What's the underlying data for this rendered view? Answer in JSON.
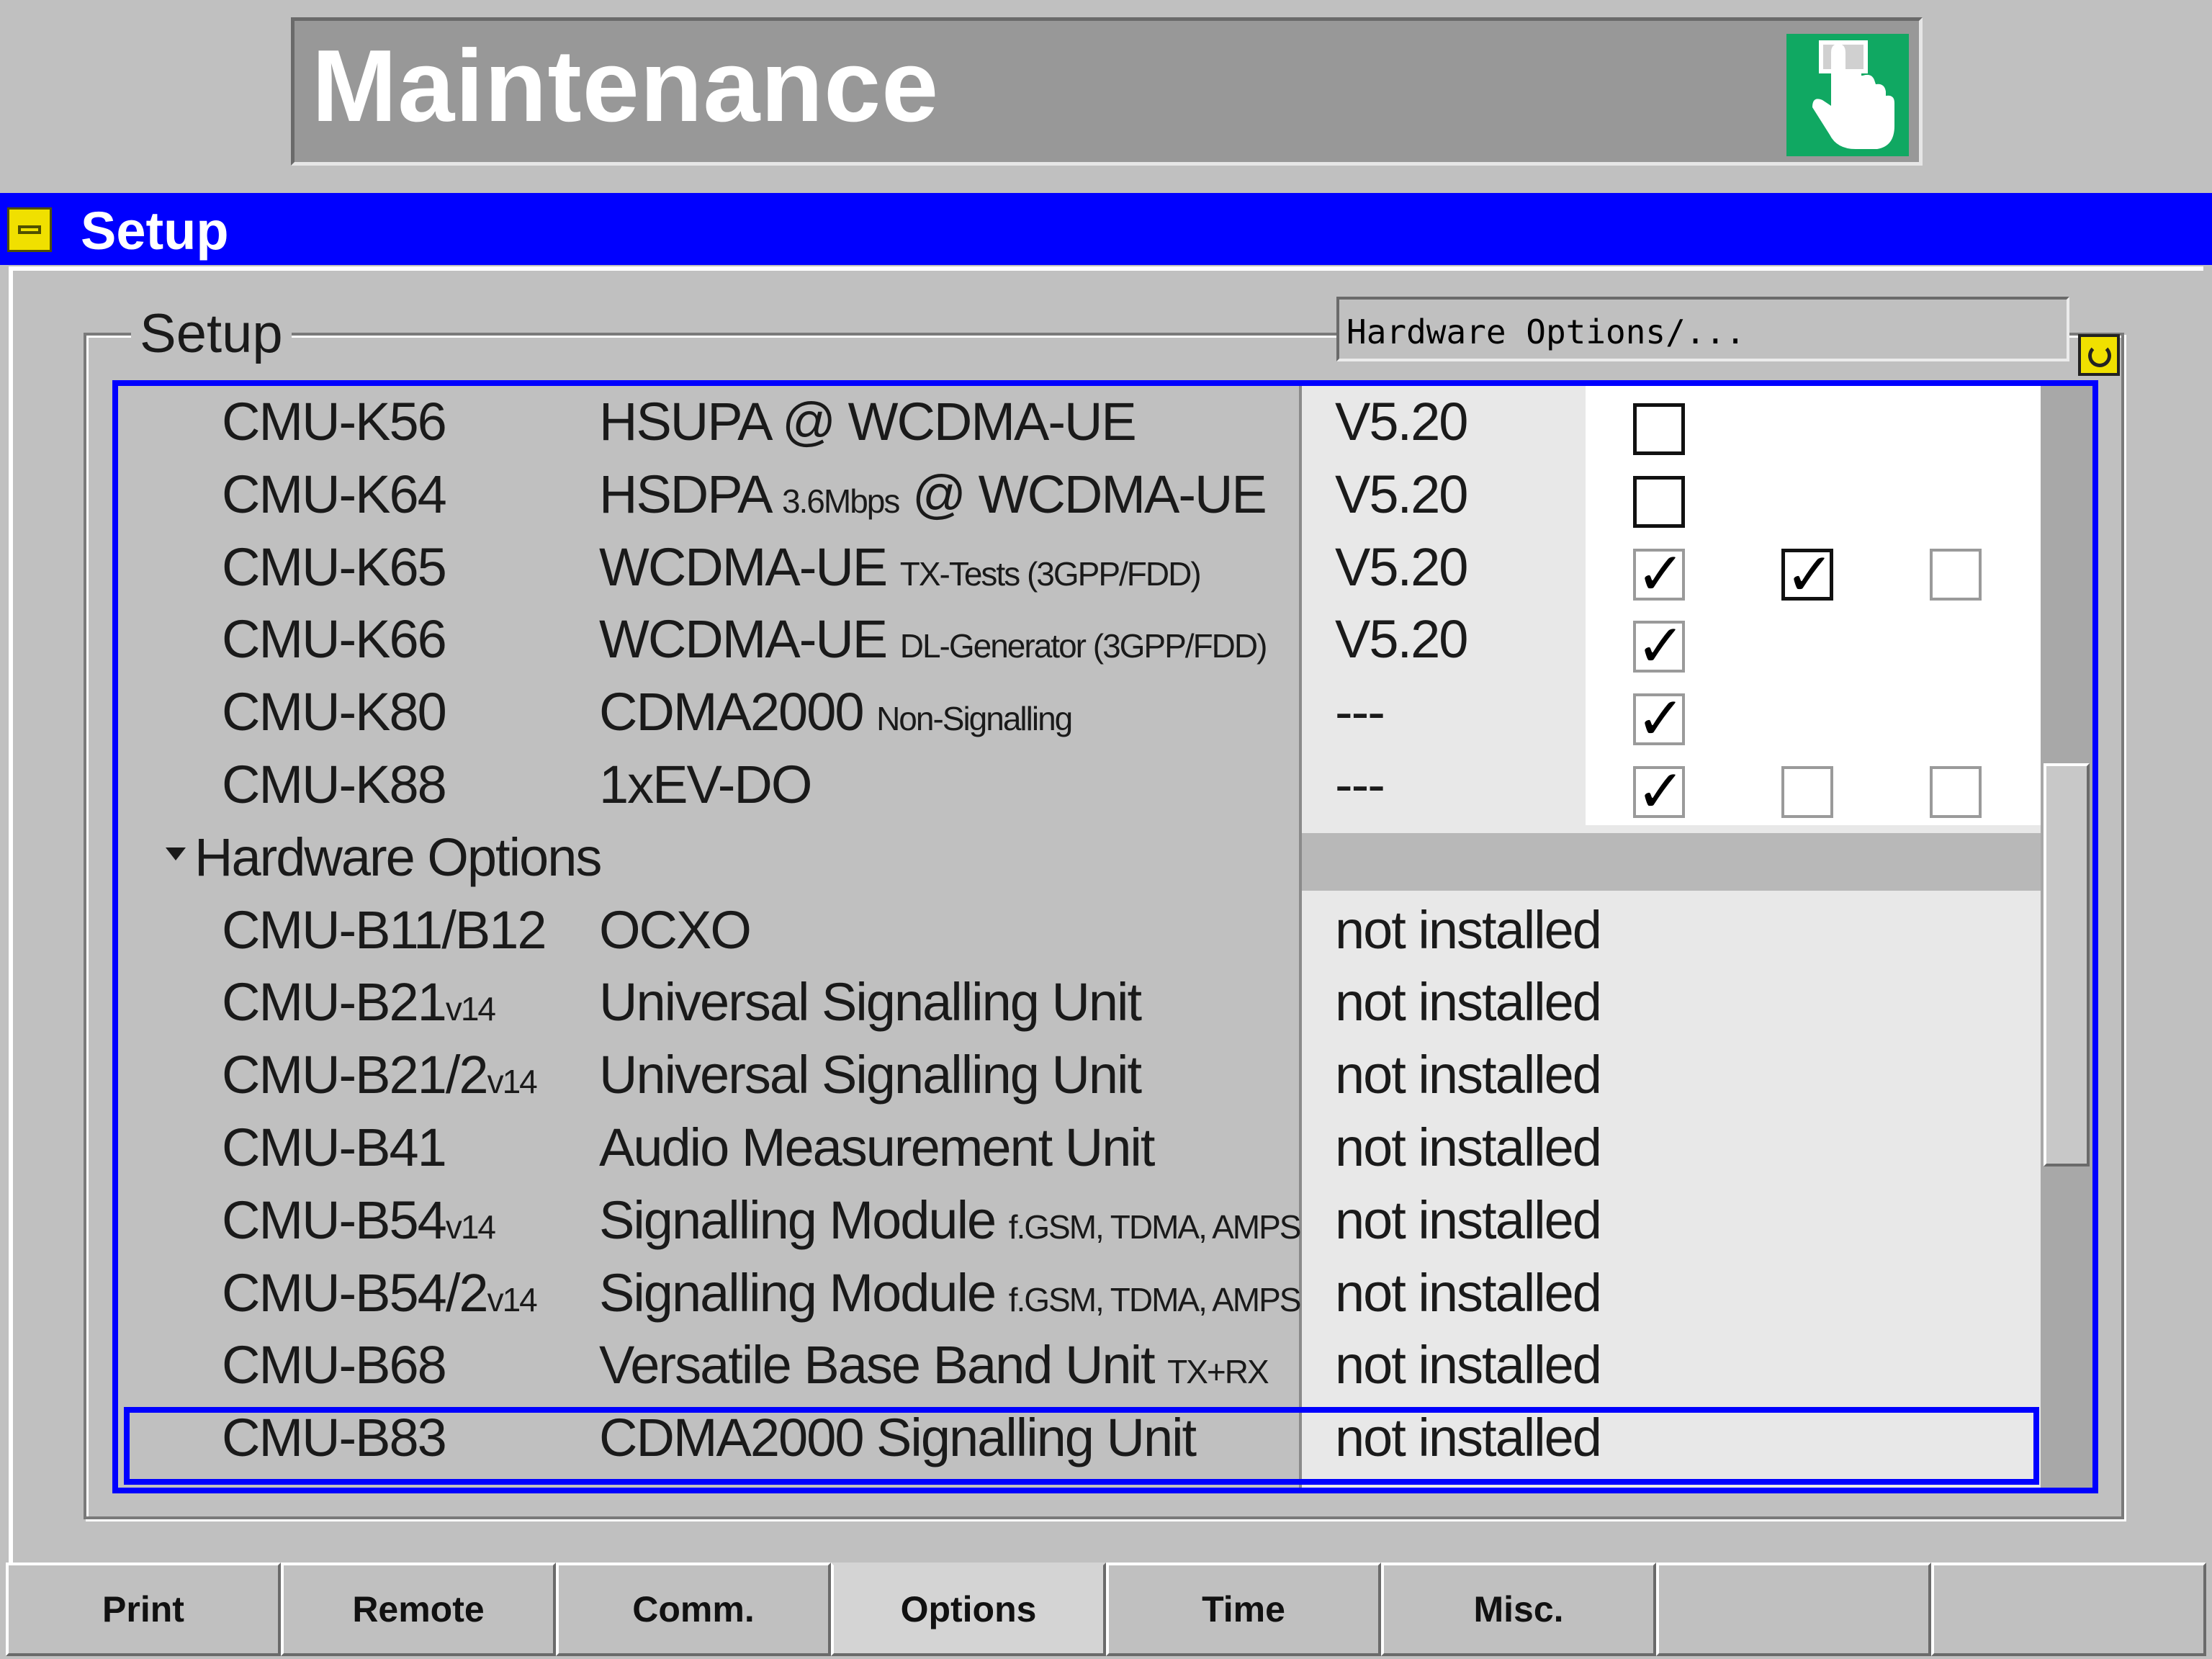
{
  "header": {
    "title": "Maintenance",
    "icon": "hand-pointer-icon",
    "icon_color": "#10a862"
  },
  "window": {
    "title": "Setup",
    "bar_color": "#0000ff"
  },
  "group": {
    "label": "Setup",
    "field_value": "Hardware Options/..."
  },
  "rows": [
    {
      "code": "CMU-K56",
      "code_sub": "",
      "name": "HSUPA @ WCDMA-UE",
      "name_sub": "",
      "value": "V5.20",
      "checkboxes": [
        {
          "state": "unchecked",
          "disabled": false
        }
      ]
    },
    {
      "code": "CMU-K64",
      "code_sub": "",
      "name": "HSDPA ",
      "name_sub": "3.6Mbps",
      "name_tail": " @ WCDMA-UE",
      "value": "V5.20",
      "checkboxes": [
        {
          "state": "unchecked",
          "disabled": false
        }
      ]
    },
    {
      "code": "CMU-K65",
      "code_sub": "",
      "name": "WCDMA-UE ",
      "name_sub": "TX-Tests (3GPP/FDD)",
      "value": "V5.20",
      "checkboxes": [
        {
          "state": "checked",
          "disabled": true
        },
        {
          "state": "checked",
          "disabled": false
        },
        {
          "state": "unchecked",
          "disabled": true
        }
      ]
    },
    {
      "code": "CMU-K66",
      "code_sub": "",
      "name": "WCDMA-UE ",
      "name_sub": "DL-Generator (3GPP/FDD)",
      "value": "V5.20",
      "checkboxes": [
        {
          "state": "checked",
          "disabled": true
        }
      ]
    },
    {
      "code": "CMU-K80",
      "code_sub": "",
      "name": "CDMA2000 ",
      "name_sub": "Non-Signalling",
      "value": "---",
      "checkboxes": [
        {
          "state": "checked",
          "disabled": true
        }
      ]
    },
    {
      "code": "CMU-K88",
      "code_sub": "",
      "name": "1xEV-DO",
      "name_sub": "",
      "value": "---",
      "checkboxes": [
        {
          "state": "checked",
          "disabled": true
        },
        {
          "state": "unchecked",
          "disabled": true
        },
        {
          "state": "unchecked",
          "disabled": true
        }
      ]
    }
  ],
  "section": {
    "label": "Hardware Options"
  },
  "hw_rows": [
    {
      "code": "CMU-B11/B12",
      "code_sub": "",
      "name": "OCXO",
      "name_sub": "",
      "value": "not installed"
    },
    {
      "code": "CMU-B21",
      "code_sub": "v14",
      "name": "Universal Signalling Unit",
      "name_sub": "",
      "value": "not installed"
    },
    {
      "code": "CMU-B21/2",
      "code_sub": "v14",
      "name": "Universal Signalling Unit",
      "name_sub": "",
      "value": "not installed"
    },
    {
      "code": "CMU-B41",
      "code_sub": "",
      "name": "Audio Measurement Unit",
      "name_sub": "",
      "value": "not installed"
    },
    {
      "code": "CMU-B54",
      "code_sub": "v14",
      "name": "Signalling Module ",
      "name_sub": "f.GSM, TDMA, AMPS",
      "value": "not installed"
    },
    {
      "code": "CMU-B54/2",
      "code_sub": "v14",
      "name": "Signalling Module ",
      "name_sub": "f.GSM, TDMA, AMPS",
      "value": "not installed"
    },
    {
      "code": "CMU-B68",
      "code_sub": "",
      "name": "Versatile Base Band Unit ",
      "name_sub": "TX+RX",
      "value": "not installed"
    },
    {
      "code": "CMU-B83",
      "code_sub": "",
      "name": "CDMA2000 Signalling Unit",
      "name_sub": "",
      "value": "not installed",
      "selected": true
    }
  ],
  "tabs": [
    {
      "label": "Print"
    },
    {
      "label": "Remote"
    },
    {
      "label": "Comm."
    },
    {
      "label": "Options",
      "active": true
    },
    {
      "label": "Time"
    },
    {
      "label": "Misc."
    },
    {
      "label": ""
    },
    {
      "label": ""
    }
  ]
}
